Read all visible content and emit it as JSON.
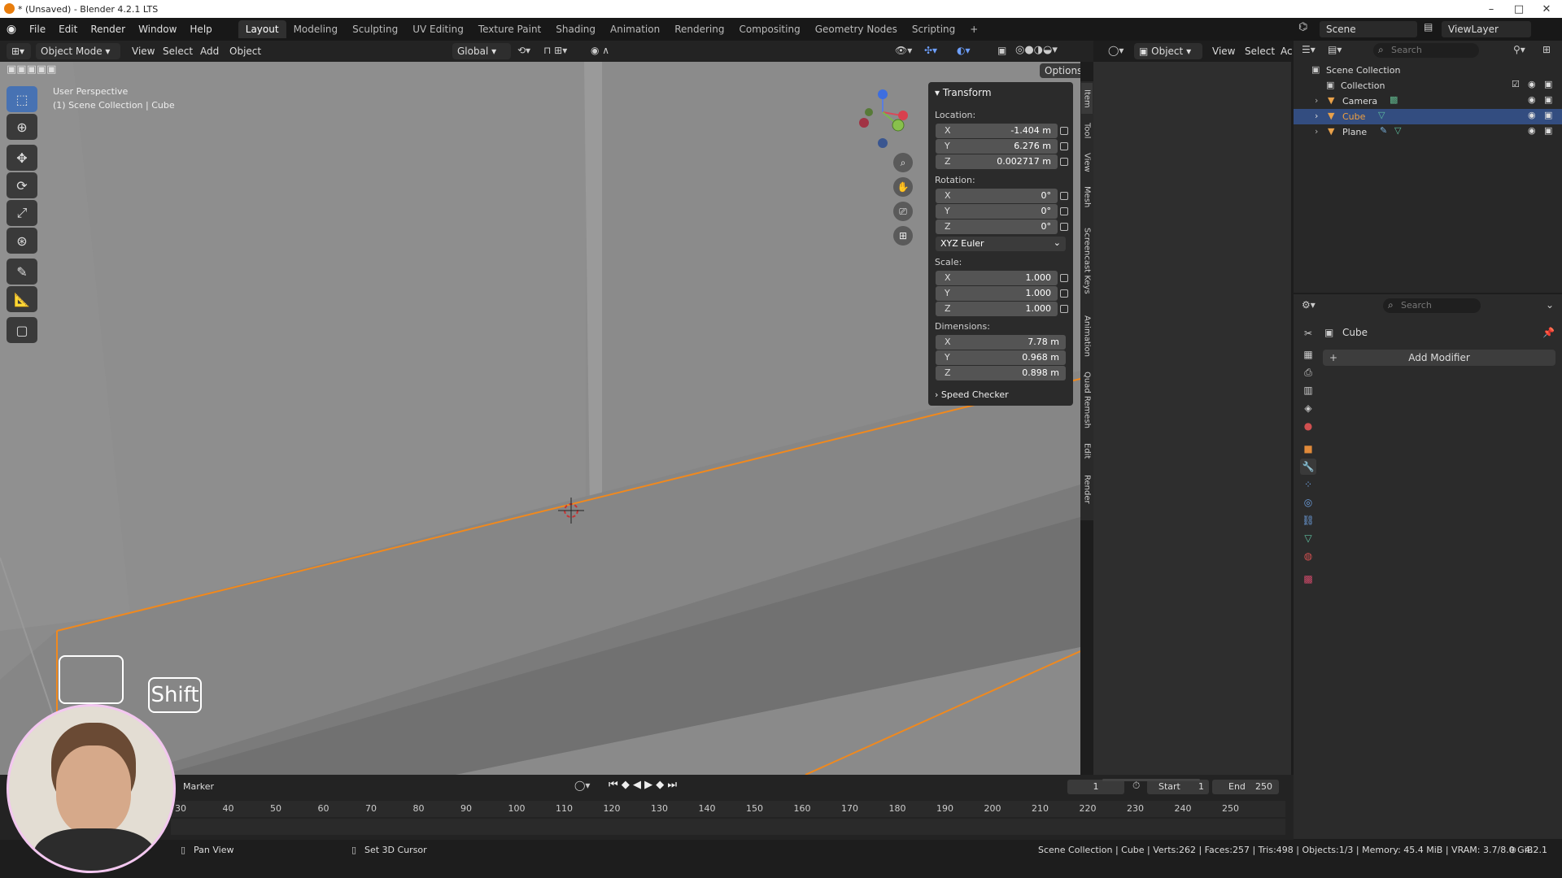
{
  "window": {
    "title": "* (Unsaved) - Blender 4.2.1 LTS"
  },
  "menu": [
    "File",
    "Edit",
    "Render",
    "Window",
    "Help"
  ],
  "workspaces": [
    "Layout",
    "Modeling",
    "Sculpting",
    "UV Editing",
    "Texture Paint",
    "Shading",
    "Animation",
    "Rendering",
    "Compositing",
    "Geometry Nodes",
    "Scripting"
  ],
  "workspace_add": "+",
  "header": {
    "mode": "Object Mode",
    "view": "View",
    "select": "Select",
    "add": "Add",
    "object": "Object",
    "transform_orient": "Global",
    "options": "Options",
    "object_right": "Object",
    "view_right": "View",
    "select_right": "Select",
    "ac": "Ac"
  },
  "scene": {
    "name": "Scene",
    "view_layer": "ViewLayer"
  },
  "viewport": {
    "perspective": "User Perspective",
    "context": "(1) Scene Collection | Cube"
  },
  "transform": {
    "title": "Transform",
    "location_label": "Location:",
    "location": [
      {
        "axis": "X",
        "value": "-1.404 m"
      },
      {
        "axis": "Y",
        "value": "6.276 m"
      },
      {
        "axis": "Z",
        "value": "0.002717 m"
      }
    ],
    "rotation_label": "Rotation:",
    "rotation": [
      {
        "axis": "X",
        "value": "0°"
      },
      {
        "axis": "Y",
        "value": "0°"
      },
      {
        "axis": "Z",
        "value": "0°"
      }
    ],
    "rotation_mode": "XYZ Euler",
    "scale_label": "Scale:",
    "scale": [
      {
        "axis": "X",
        "value": "1.000"
      },
      {
        "axis": "Y",
        "value": "1.000"
      },
      {
        "axis": "Z",
        "value": "1.000"
      }
    ],
    "dimensions_label": "Dimensions:",
    "dimensions": [
      {
        "axis": "X",
        "value": "7.78 m"
      },
      {
        "axis": "Y",
        "value": "0.968 m"
      },
      {
        "axis": "Z",
        "value": "0.898 m"
      }
    ],
    "speed_checker": "Speed Checker"
  },
  "side_tabs": [
    "Item",
    "Tool",
    "View",
    "Mesh",
    "Screencast Keys",
    "Animation",
    "Quad Remesh",
    "Edit",
    "Render"
  ],
  "outliner": {
    "search_placeholder": "Search",
    "rows": [
      {
        "name": "Scene Collection"
      },
      {
        "name": "Collection"
      },
      {
        "name": "Camera"
      },
      {
        "name": "Cube"
      },
      {
        "name": "Plane"
      }
    ]
  },
  "properties": {
    "search_placeholder": "Search",
    "object": "Cube",
    "add_modifier": "Add Modifier"
  },
  "timeline": {
    "marker": "Marker",
    "current_frame": "1",
    "start_label": "Start",
    "start": "1",
    "end_label": "End",
    "end": "250",
    "ticks": [
      "30",
      "40",
      "50",
      "60",
      "70",
      "80",
      "90",
      "100",
      "110",
      "120",
      "130",
      "140",
      "150",
      "160",
      "170",
      "180",
      "190",
      "200",
      "210",
      "220",
      "230",
      "240",
      "250"
    ]
  },
  "status": {
    "pan": "Pan View",
    "cursor": "Set 3D Cursor",
    "stats": "Scene Collection | Cube | Verts:262 | Faces:257 | Tris:498 | Objects:1/3 | Memory: 45.4 MiB | VRAM: 3.7/8.0 GiB",
    "version": "4.2.1"
  },
  "keys": {
    "shift": "Shift"
  },
  "colors": {
    "accent": "#4772b3",
    "selection_outline": "#f0891e",
    "selected_row": "#334d80"
  }
}
